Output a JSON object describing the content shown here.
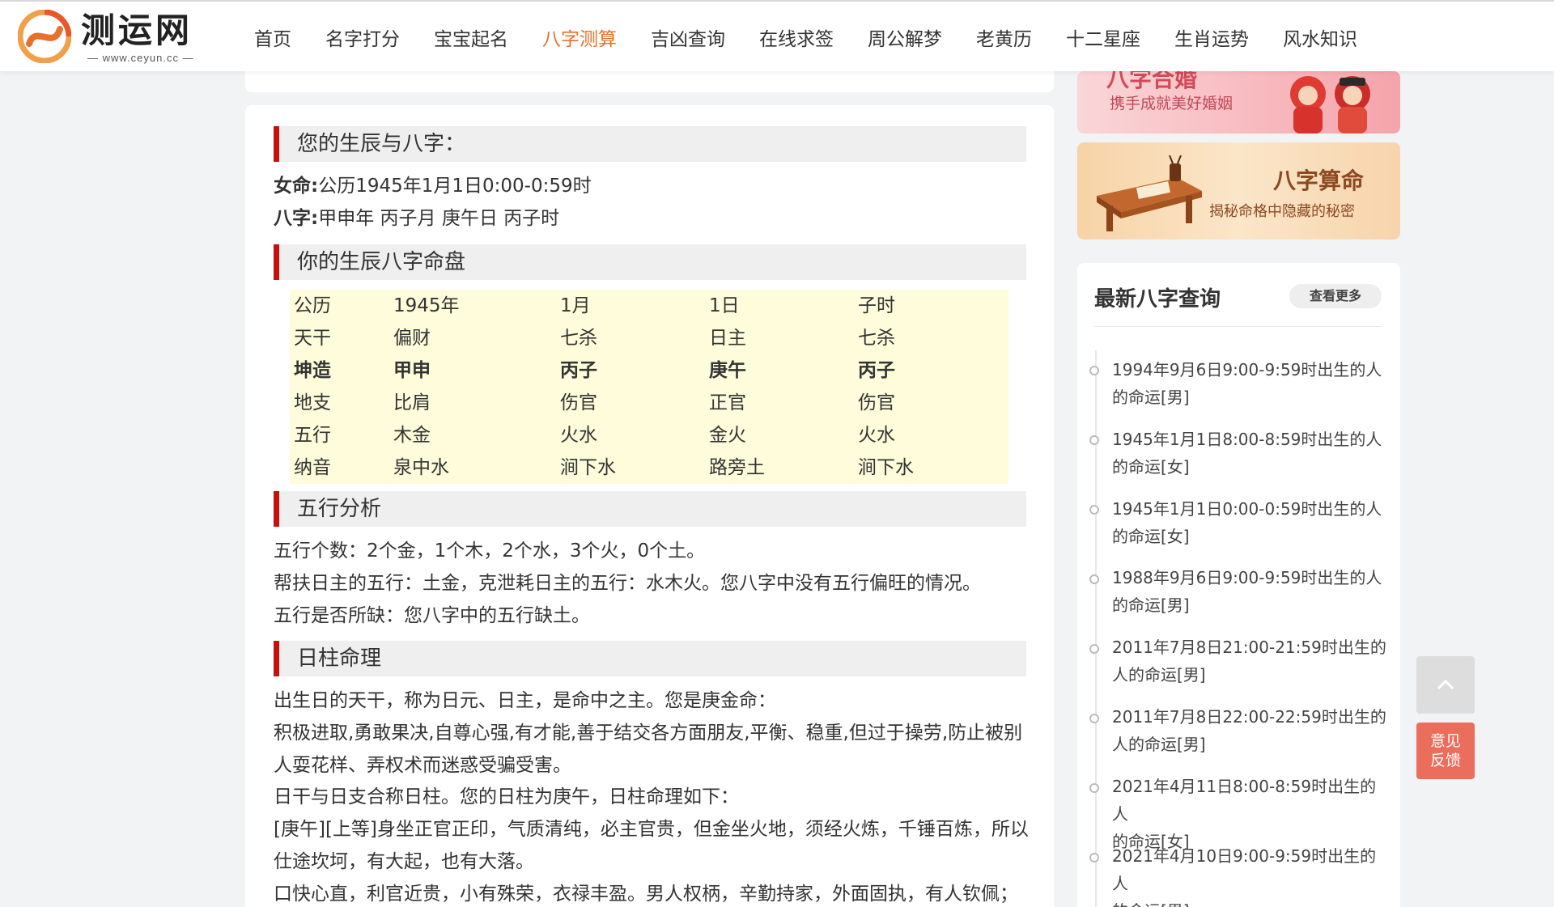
{
  "header": {
    "logo_name": "测运网",
    "logo_url": "— www.ceyun.cc —",
    "nav": [
      "首页",
      "名字打分",
      "宝宝起名",
      "八字测算",
      "吉凶查询",
      "在线求签",
      "周公解梦",
      "老黄历",
      "十二星座",
      "生肖运势",
      "风水知识"
    ],
    "active_index": 3
  },
  "main": {
    "sec1_title": "您的生辰与八字：",
    "gender_label": "女命:",
    "gender_value": "公历1945年1月1日0:00-0:59时",
    "bazi_label": "八字:",
    "bazi_value": "甲申年 丙子月 庚午日 丙子时",
    "sec2_title": "你的生辰八字命盘",
    "pan": [
      [
        "公历",
        "1945年",
        "1月",
        "1日",
        "子时"
      ],
      [
        "天干",
        "偏财",
        "七杀",
        "日主",
        "七杀"
      ],
      [
        "坤造",
        "甲申",
        "丙子",
        "庚午",
        "丙子"
      ],
      [
        "地支",
        "比肩",
        "伤官",
        "正官",
        "伤官"
      ],
      [
        "五行",
        "木金",
        "火水",
        "金火",
        "火水"
      ],
      [
        "纳音",
        "泉中水",
        "涧下水",
        "路旁土",
        "涧下水"
      ]
    ],
    "sec3_title": "五行分析",
    "wx1": "五行个数：2个金，1个木，2个水，3个火，0个土。",
    "wx2": "帮扶日主的五行：土金，克泄耗日主的五行：水木火。您八字中没有五行偏旺的情况。",
    "wx3": "五行是否所缺：您八字中的五行缺土。",
    "sec4_title": "日柱命理",
    "rz1": "出生日的天干，称为日元、日主，是命中之主。您是庚金命：",
    "rz2": "积极进取,勇敢果决,自尊心强,有才能,善于结交各方面朋友,平衡、稳重,但过于操劳,防止被别",
    "rz3": "人耍花样、弄权术而迷惑受骗受害。",
    "rz4": "日干与日支合称日柱。您的日柱为庚午，日柱命理如下：",
    "rz5": "[庚午][上等]身坐正官正印，气质清纯，必主官贵，但金坐火地，须经火炼，千锤百炼，所以",
    "rz6": "仕途坎坷，有大起，也有大落。",
    "rz7": "口快心直，利官近贵，小有殊荣，衣禄丰盈。男人权柄，辛勤持家，外面固执，有人钦佩；"
  },
  "side": {
    "banner1_title": "八字合婚",
    "banner1_sub": "携手成就美好婚姻",
    "banner2_title": "八字算命",
    "banner2_sub": "揭秘命格中隐藏的秘密",
    "list_title": "最新八字查询",
    "more": "查看更多",
    "items": [
      {
        "l1": "1994年9月6日9:00-9:59时出生的人",
        "l2": "的命运[男]"
      },
      {
        "l1": "1945年1月1日8:00-8:59时出生的人",
        "l2": "的命运[女]"
      },
      {
        "l1": "1945年1月1日0:00-0:59时出生的人",
        "l2": "的命运[女]"
      },
      {
        "l1": "1988年9月6日9:00-9:59时出生的人",
        "l2": "的命运[男]"
      },
      {
        "l1": "2011年7月8日21:00-21:59时出生的",
        "l2": "人的命运[男]"
      },
      {
        "l1": "2011年7月8日22:00-22:59时出生的",
        "l2": "人的命运[男]"
      },
      {
        "l1": "2021年4月11日8:00-8:59时出生的人",
        "l2": "的命运[女]"
      },
      {
        "l1": "2021年4月10日9:00-9:59时出生的人",
        "l2": "的命运[男]"
      }
    ]
  },
  "float": {
    "feedback_l1": "意见",
    "feedback_l2": "反馈"
  },
  "colors": {
    "accent": "#e6712c",
    "section_bar": "#c80f0f",
    "pan_bg": "#fefcda",
    "feedback": "#ea6e5b"
  }
}
